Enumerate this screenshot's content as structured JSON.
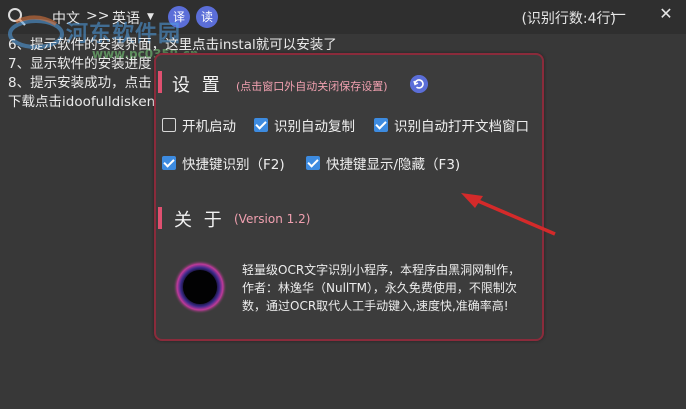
{
  "titlebar": {
    "lang_from": "中文",
    "separator": ">>",
    "lang_to": "英语",
    "lang_to_caret": "▼",
    "btn_translate": "译",
    "btn_read": "读",
    "line_count": "(识别行数:4行)",
    "minimize": "—",
    "close": "✕"
  },
  "background_lines": [
    "6、提示软件的安装界面，这里点击instal就可以安装了",
    "7、显示软件的安装进度",
    "8、提示安装成功，点击",
    "下载点击idoofulldisken"
  ],
  "watermark": {
    "text": "河东软件园",
    "url": "www.pc0359.cn"
  },
  "settings": {
    "title": "设 置",
    "hint": "(点击窗口外自动关闭保存设置)",
    "options": [
      {
        "label": "开机启动",
        "checked": false
      },
      {
        "label": "识别自动复制",
        "checked": true
      },
      {
        "label": "识别自动打开文档窗口",
        "checked": true
      },
      {
        "label": "快捷键识别（F2)",
        "checked": true
      },
      {
        "label": "快捷键显示/隐藏（F3)",
        "checked": true
      }
    ]
  },
  "about": {
    "title": "关 于",
    "version": "(Version 1.2)",
    "lines": [
      "轻量级OCR文字识别小程序，本程序由黑洞网制作，",
      "作者：林逸华（NullTM），永久免费使用，不限制次",
      "数，通过OCR取代人工手动键入,速度快,准确率高!"
    ]
  },
  "colors": {
    "accent_blue": "#3d8be0",
    "button_blue": "#5b6ed8",
    "panel_border": "#8a2b3b",
    "section_bar": "#e05070",
    "arrow_red": "#d42a2a"
  }
}
